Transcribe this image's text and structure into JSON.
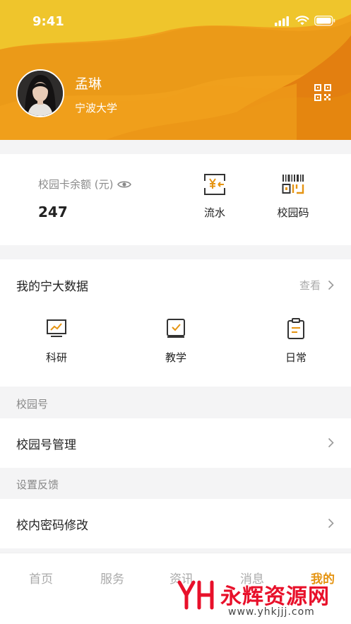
{
  "status": {
    "time": "9:41"
  },
  "profile": {
    "name": "孟琳",
    "school": "宁波大学"
  },
  "card": {
    "balance_label": "校园卡余额 (元)",
    "balance_value": "247",
    "actions": [
      {
        "label": "流水",
        "icon": "yen-exchange-icon"
      },
      {
        "label": "校园码",
        "icon": "barcode-icon"
      }
    ]
  },
  "data": {
    "title": "我的宁大数据",
    "view_more": "查看",
    "items": [
      {
        "label": "科研",
        "icon": "research-chart-icon"
      },
      {
        "label": "教学",
        "icon": "teaching-book-icon"
      },
      {
        "label": "日常",
        "icon": "clipboard-icon"
      }
    ]
  },
  "sections": {
    "campus_label": "校园号",
    "campus_manage": "校园号管理",
    "settings_label": "设置反馈",
    "password_change": "校内密码修改"
  },
  "tabs": [
    "首页",
    "服务",
    "资讯",
    "消息",
    "我的"
  ],
  "active_tab": "我的",
  "watermark": {
    "text": "永辉资源网",
    "url": "www.yhkjjj.com"
  },
  "colors": {
    "accent": "#e59412",
    "header_yellow": "#f0b82a",
    "header_orange": "#e0700f"
  }
}
